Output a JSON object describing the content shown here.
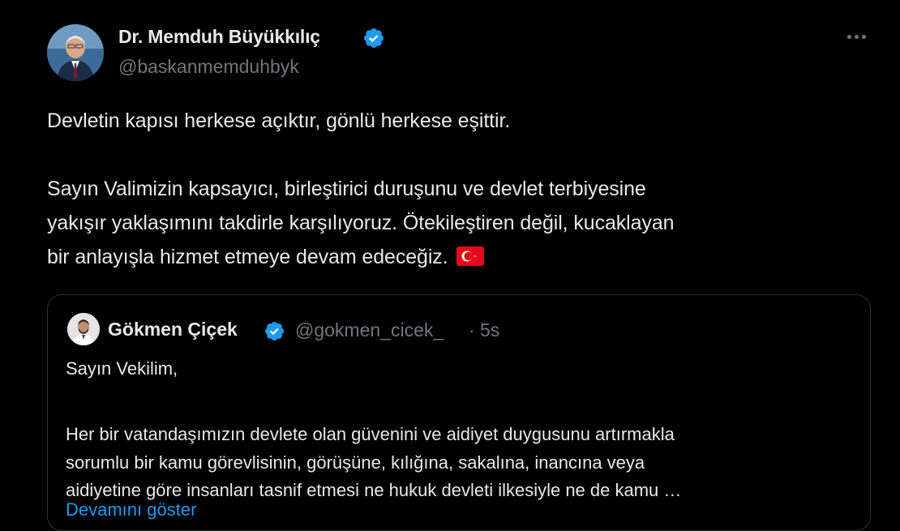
{
  "colors": {
    "background": "#000000",
    "text_primary": "#e7e9ea",
    "text_secondary": "#71767b",
    "verified_blue": "#1d9bf0",
    "border": "#2f3336"
  },
  "author": {
    "name": "Dr. Memduh Büyükkılıç",
    "handle": "@baskanmemduhbyk",
    "verified_icon": "verified-badge-icon",
    "avatar_icon": "avatar"
  },
  "more_icon": "more-options-icon",
  "tweet": {
    "line1": "Devletin kapısı herkese açıktır, gönlü herkese eşittir.",
    "line2": "Sayın Valimizin kapsayıcı, birleştirici duruşunu ve devlet terbiyesine",
    "line3": "yakışır yaklaşımını takdirle karşılıyoruz. Ötekileştiren değil, kucaklayan",
    "line4": "bir anlayışla hizmet etmeye devam edeceğiz.",
    "flag_icon": "turkey-flag-icon"
  },
  "quote": {
    "name": "Gökmen Çiçek",
    "handle": "@gokmen_cicek_",
    "separator": "·",
    "time": "5s",
    "greeting": "Sayın Vekilim,",
    "line1": "Her bir vatandaşımızın devlete olan güvenini ve aidiyet duygusunu artırmakla",
    "line2": "sorumlu bir kamu görevlisinin, görüşüne, kılığına, sakalına, inancına veya",
    "line3": "aidiyetine göre insanları tasnif etmesi ne hukuk devleti ilkesiyle ne de kamu …",
    "show_more": "Devamını göster"
  }
}
